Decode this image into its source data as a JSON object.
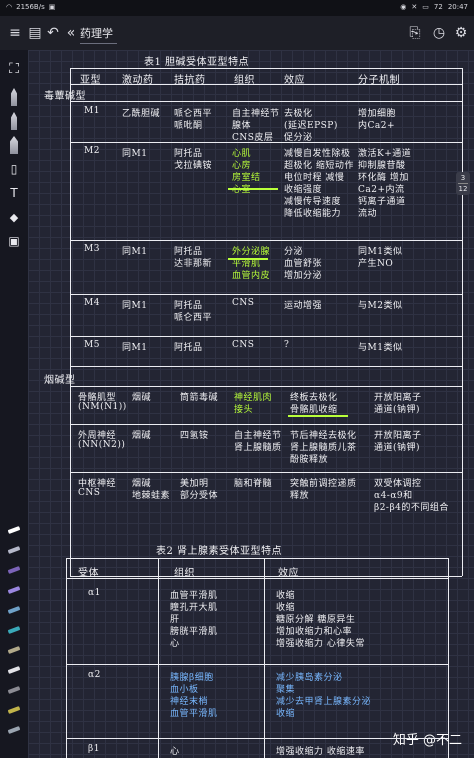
{
  "status_bar": {
    "left": "2156B/s",
    "right_time": "20:47",
    "battery": "72"
  },
  "toolbar": {
    "title": "药理学"
  },
  "page_indicator": {
    "current": "3",
    "total": "12"
  },
  "watermark": "知乎 @不二",
  "table1": {
    "title": "表1  胆碱受体亚型特点",
    "headers": [
      "亚型",
      "激动药",
      "拮抗药",
      "组织",
      "效应",
      "分子机制"
    ],
    "section_muscarinic": "毒蕈碱型",
    "rows": [
      {
        "subtype": "M1",
        "agonist": "乙酰胆碱",
        "antagonist": "哌仑西平\n哌吡酮",
        "tissue": "自主神经节\n腺体\nCNS皮层",
        "effect": "去极化\n(延迟EPSP)\n促分泌",
        "mechanism": "增加细胞\n内Ca2+"
      },
      {
        "subtype": "M2",
        "agonist": "同M1",
        "antagonist": "阿托品\n戈拉碘铵",
        "tissue": "心肌\n心房\n房室结\n心室",
        "effect": "减慢自发性除极\n超极化 缩短动作\n电位时程 减慢\n收缩强度\n减慢传导速度\n降低收缩能力",
        "mechanism": "激活K+通道\n抑制腺苷酸\n环化酶 增加\nCa2+内流\n钙离子通道\n流动"
      },
      {
        "subtype": "M3",
        "agonist": "同M1",
        "antagonist": "阿托品\n达非那新",
        "tissue": "外分泌腺\n平滑肌\n血管内皮",
        "effect": "分泌\n血管舒张\n增加分泌",
        "mechanism": "同M1类似\n产生NO"
      },
      {
        "subtype": "M4",
        "agonist": "同M1",
        "antagonist": "阿托品\n哌仑西平",
        "tissue": "CNS",
        "effect": "运动增强",
        "mechanism": "与M2类似"
      },
      {
        "subtype": "M5",
        "agonist": "同M1",
        "antagonist": "阿托品",
        "tissue": "CNS",
        "effect": "?",
        "mechanism": "与M1类似"
      }
    ],
    "section_nicotinic": "烟碱型",
    "nrows": [
      {
        "subtype": "骨骼肌型\n(NM(N1))",
        "agonist": "烟碱",
        "antagonist": "筒箭毒碱",
        "tissue": "神经肌肉\n接头",
        "effect": "终板去极化\n骨骼肌收缩",
        "mechanism": "开放阳离子\n通道(钠钾)"
      },
      {
        "subtype": "外周神经\n(NN(N2))",
        "agonist": "烟碱",
        "antagonist": "四氢铵",
        "tissue": "自主神经节\n肾上腺髓质",
        "effect": "节后神经去极化\n肾上腺髓质儿茶\n酚胺释放",
        "mechanism": "开放阳离子\n通道(钠钾)"
      },
      {
        "subtype": "中枢神经\nCNS",
        "agonist": "烟碱\n地棘蛙素",
        "antagonist": "美加明\n部分受体",
        "tissue": "脑和脊髓",
        "effect": "突触前调控递质\n释放",
        "mechanism": "双受体调控\nα4-α9和\nβ2-β4的不同组合"
      }
    ]
  },
  "table2": {
    "title": "表2  肾上腺素受体亚型特点",
    "headers": [
      "受体",
      "组织",
      "效应"
    ],
    "rows": [
      {
        "receptor": "α1",
        "tissue": "血管平滑肌\n瞳孔开大肌\n肝\n膀胱平滑肌\n心",
        "effect": "收缩\n收缩\n糖原分解 糖原异生\n增加收缩力和心率\n增强收缩力 心律失常"
      },
      {
        "receptor": "α2",
        "tissue": "胰腺β细胞\n血小板\n神经末梢\n血管平滑肌",
        "effect": "减少胰岛素分泌\n聚集\n减少去甲肾上腺素分泌\n收缩"
      },
      {
        "receptor": "β1",
        "tissue": "心",
        "effect": "增强收缩力 收缩速率"
      }
    ]
  }
}
